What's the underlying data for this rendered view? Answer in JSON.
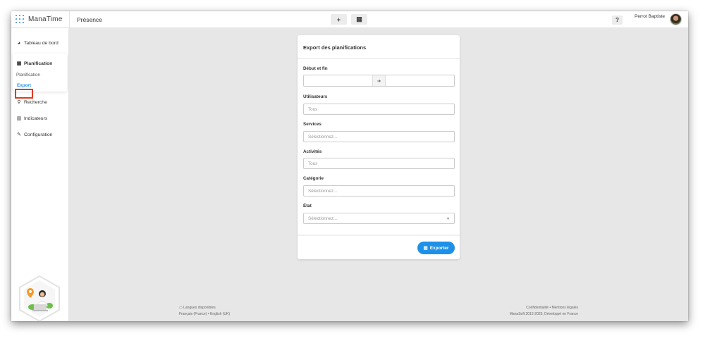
{
  "app": {
    "name": "ManaTime",
    "page_title": "Présence"
  },
  "toolbar": {
    "add_label": "+",
    "calendar_label": "▦",
    "help_label": "?"
  },
  "user": {
    "name": "Perrot Baptiste"
  },
  "sidebar": {
    "items": [
      {
        "label": "Tableau de bord",
        "icon": "dashboard-icon"
      },
      {
        "label": "Planification",
        "icon": "calendar-icon"
      },
      {
        "label": "Recherche",
        "icon": "search-icon"
      },
      {
        "label": "Indicateurs",
        "icon": "chart-icon"
      },
      {
        "label": "Configuration",
        "icon": "wrench-icon"
      }
    ],
    "sub_items": [
      {
        "label": "Planification"
      },
      {
        "label": "Export",
        "active": true
      }
    ]
  },
  "form": {
    "title": "Export des planifications",
    "date_range_label": "Début et fin",
    "users_label": "Utilisateurs",
    "users_placeholder": "Tous",
    "services_label": "Services",
    "services_placeholder": "Sélectionnez...",
    "activities_label": "Activités",
    "activities_placeholder": "Tous",
    "category_label": "Catégorie",
    "category_placeholder": "Sélectionnez...",
    "state_label": "État",
    "state_placeholder": "Sélectionnez...",
    "export_button": "Exporter"
  },
  "footer": {
    "languages_title": "Langues disponibles",
    "languages": "Français (France) • English (UK)",
    "links": "Confidentialité • Mentions légales",
    "copyright": "ManaSoft 2012-2025, Développé en France"
  },
  "colors": {
    "accent": "#1e90e8",
    "highlight": "#e5391f",
    "logo": "#2f8de4"
  }
}
